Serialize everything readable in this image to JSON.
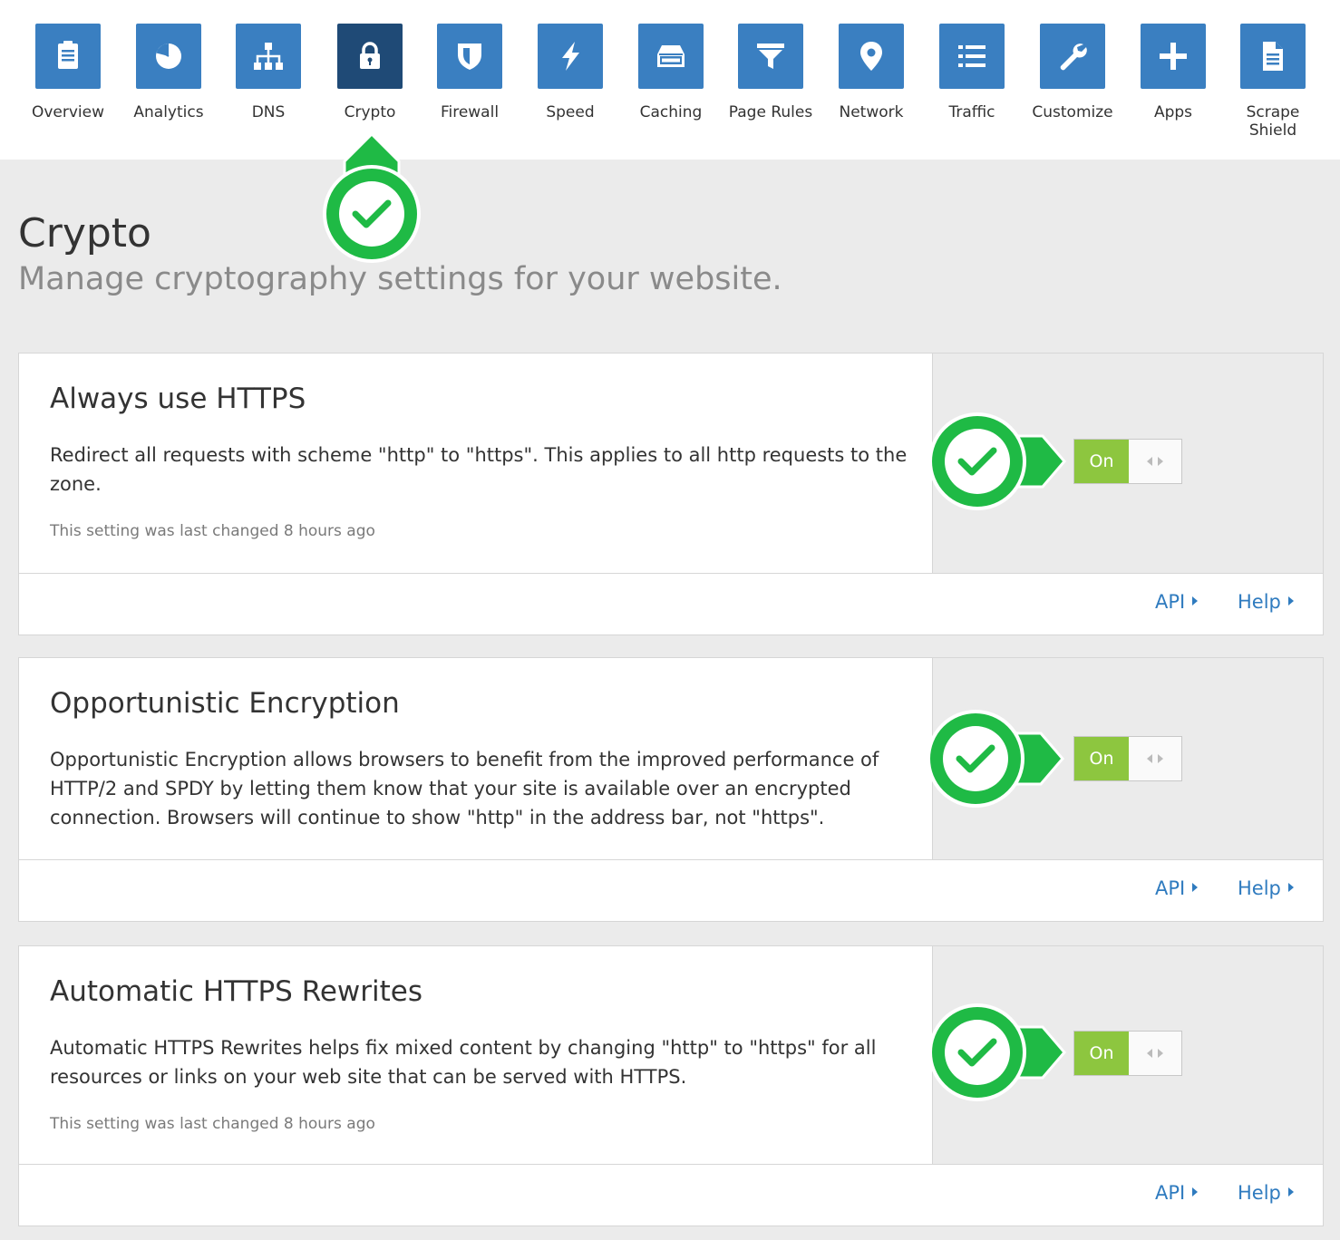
{
  "nav": {
    "items": [
      {
        "label": "Overview",
        "icon": "document-icon"
      },
      {
        "label": "Analytics",
        "icon": "pie-chart-icon"
      },
      {
        "label": "DNS",
        "icon": "network-tree-icon"
      },
      {
        "label": "Crypto",
        "icon": "lock-icon"
      },
      {
        "label": "Firewall",
        "icon": "shield-icon"
      },
      {
        "label": "Speed",
        "icon": "lightning-icon"
      },
      {
        "label": "Caching",
        "icon": "server-drive-icon"
      },
      {
        "label": "Page Rules",
        "icon": "filter-icon"
      },
      {
        "label": "Network",
        "icon": "map-pin-icon"
      },
      {
        "label": "Traffic",
        "icon": "list-icon"
      },
      {
        "label": "Customize",
        "icon": "wrench-icon"
      },
      {
        "label": "Apps",
        "icon": "plus-icon"
      },
      {
        "label": "Scrape Shield",
        "icon": "file-icon"
      }
    ],
    "active": "Crypto",
    "tile_color": "#3a7fc1",
    "active_tile_color": "#1f4a76"
  },
  "page": {
    "title": "Crypto",
    "subtitle": "Manage cryptography settings for your website."
  },
  "settings": [
    {
      "title": "Always use HTTPS",
      "description": "Redirect all requests with scheme \"http\" to \"https\". This applies to all http requests to the zone.",
      "meta": "This setting was last changed 8 hours ago",
      "toggle_label": "On",
      "api_label": "API",
      "help_label": "Help"
    },
    {
      "title": "Opportunistic Encryption",
      "description": "Opportunistic Encryption allows browsers to benefit from the improved performance of HTTP/2 and SPDY by letting them know that your site is available over an encrypted connection. Browsers will continue to show \"http\" in the address bar, not \"https\".",
      "meta": "",
      "toggle_label": "On",
      "api_label": "API",
      "help_label": "Help"
    },
    {
      "title": "Automatic HTTPS Rewrites",
      "description": "Automatic HTTPS Rewrites helps fix mixed content by changing \"http\" to \"https\" for all resources or links on your web site that can be served with HTTPS.",
      "meta": "This setting was last changed 8 hours ago",
      "toggle_label": "On",
      "api_label": "API",
      "help_label": "Help"
    }
  ],
  "colors": {
    "toggle_on": "#8dc63f",
    "link": "#2f7bbf",
    "callout_green": "#1fba45"
  }
}
